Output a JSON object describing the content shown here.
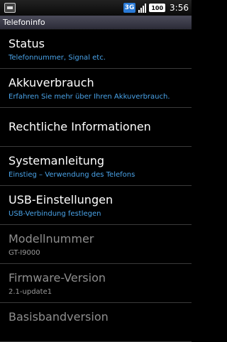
{
  "statusbar": {
    "network": "3G",
    "battery": "100",
    "time": "3:56",
    "icons": [
      "usb-icon",
      "3g-icon",
      "signal-icon",
      "battery-icon"
    ]
  },
  "title": "Telefoninfo",
  "items": [
    {
      "title": "Status",
      "subtitle": "Telefonnummer, Signal etc."
    },
    {
      "title": "Akkuverbrauch",
      "subtitle": "Erfahren Sie mehr über Ihren Akkuverbrauch."
    },
    {
      "title": "Rechtliche Informationen"
    },
    {
      "title": "Systemanleitung",
      "subtitle": "Einstieg – Verwendung des Telefons"
    },
    {
      "title": "USB-Einstellungen",
      "subtitle": "USB-Verbindung festlegen"
    },
    {
      "title": "Modellnummer",
      "subtitle": "GT-I9000"
    },
    {
      "title": "Firmware-Version",
      "subtitle": "2.1-update1"
    },
    {
      "title": "Basisbandversion"
    }
  ],
  "colors": {
    "accent": "#4aa3e8",
    "titlebar": "#3d3d4a",
    "background": "#000000"
  }
}
